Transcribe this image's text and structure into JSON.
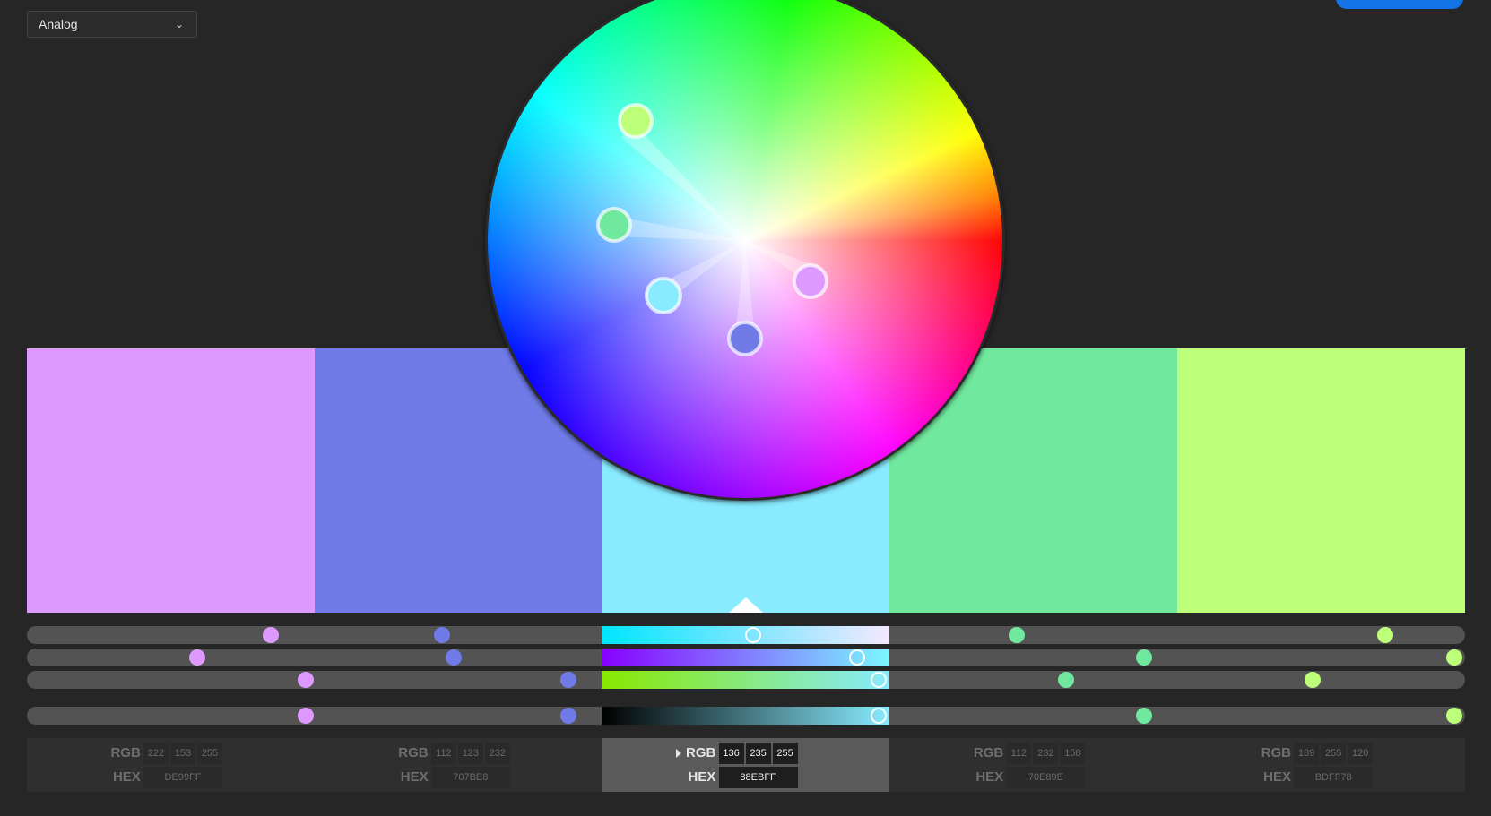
{
  "harmony_rule": {
    "selected": "Analog",
    "icon": "chevron-down-icon"
  },
  "colors": [
    {
      "hex": "#DE99FF",
      "rgb": [
        "222",
        "153",
        "255"
      ],
      "hex_label": "DE99FF",
      "active": false
    },
    {
      "hex": "#707BE8",
      "rgb": [
        "112",
        "123",
        "232"
      ],
      "hex_label": "707BE8",
      "active": false
    },
    {
      "hex": "#88EBFF",
      "rgb": [
        "136",
        "235",
        "255"
      ],
      "hex_label": "88EBFF",
      "active": true
    },
    {
      "hex": "#70E89E",
      "rgb": [
        "112",
        "232",
        "158"
      ],
      "hex_label": "70E89E",
      "active": false
    },
    {
      "hex": "#BDFF78",
      "rgb": [
        "189",
        "255",
        "120"
      ],
      "hex_label": "BDFF78",
      "active": false
    }
  ],
  "labels": {
    "rgb": "RGB",
    "hex": "HEX"
  },
  "accent_color": "#1473E6"
}
